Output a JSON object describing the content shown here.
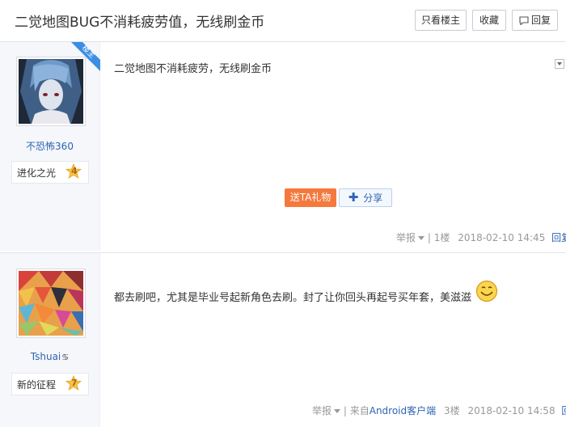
{
  "thread": {
    "title": "二觉地图BUG不消耗疲劳值，无线刷金币",
    "btn_only_op": "只看楼主",
    "btn_favorite": "收藏",
    "btn_reply": "回复"
  },
  "posts": [
    {
      "author": "不恐怖360",
      "op_badge": "楼主",
      "level_name": "进化之光",
      "level_num": "4",
      "content": "二觉地图不消耗疲劳，无线刷金币",
      "gift_label": "送TA礼物",
      "share_label": "分享",
      "report": "举报",
      "sep": "|",
      "floor": "1楼",
      "time": "2018-02-10 14:45",
      "reply": "回复"
    },
    {
      "author": "Tshuai",
      "author_icon": "cancer-zodiac-icon",
      "level_name": "新的征程",
      "level_num": "7",
      "content": "都去刷吧，尤其是毕业号起新角色去刷。封了让你回头再起号买年套，美滋滋",
      "report": "举报",
      "sep": "|",
      "source_prefix": "来自",
      "source_client": "Android客户端",
      "floor": "3楼",
      "time": "2018-02-10 14:58",
      "reply": "回复"
    }
  ]
}
